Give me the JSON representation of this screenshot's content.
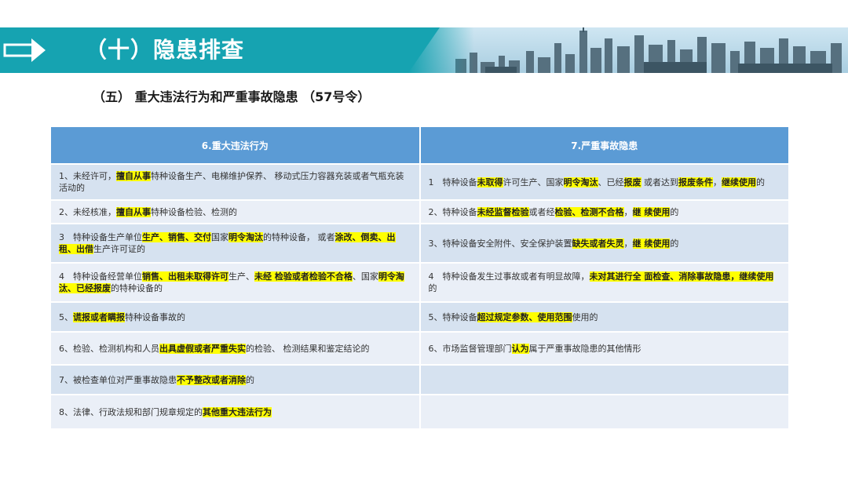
{
  "header": {
    "title": "（十）隐患排查",
    "colors": {
      "band": "#16a3b1",
      "table_header": "#5b9bd5",
      "highlight": "#ffff00"
    }
  },
  "subtitle": "（五） 重大违法行为和严重事故隐患 （57号令）",
  "table": {
    "columns": [
      "6.重大违法行为",
      "7.严重事故隐患"
    ],
    "rows": [
      [
        [
          {
            "t": "1、未经许可，"
          },
          {
            "t": "擅自从事",
            "h": true
          },
          {
            "t": "特种设备生产、电梯维护保养、 移动式压力容器充装或者气瓶充装活动的"
          }
        ],
        [
          {
            "t": "1　特种设备"
          },
          {
            "t": "未取得",
            "h": true
          },
          {
            "t": "许可生产、国家"
          },
          {
            "t": "明令淘汰",
            "h": true
          },
          {
            "t": "、已经"
          },
          {
            "t": "报废",
            "h": true
          },
          {
            "t": " 或者达到"
          },
          {
            "t": "报废条件",
            "h": true
          },
          {
            "t": "，"
          },
          {
            "t": "继续使用",
            "h": true
          },
          {
            "t": "的"
          }
        ]
      ],
      [
        [
          {
            "t": "2、未经核准，"
          },
          {
            "t": "擅自从事",
            "h": true
          },
          {
            "t": "特种设备检验、检测的"
          }
        ],
        [
          {
            "t": "2、特种设备"
          },
          {
            "t": "未经监督检验",
            "h": true
          },
          {
            "t": "或者经"
          },
          {
            "t": "检验、检测不合格",
            "h": true
          },
          {
            "t": "，"
          },
          {
            "t": "继 续使用",
            "h": true
          },
          {
            "t": "的"
          }
        ]
      ],
      [
        [
          {
            "t": "3　特种设备生产单位"
          },
          {
            "t": "生产、销售、交付",
            "h": true
          },
          {
            "t": "国家"
          },
          {
            "t": "明令淘汰",
            "h": true
          },
          {
            "t": "的特种设备， 或者"
          },
          {
            "t": "涂改、倒卖、出租、出借",
            "h": true
          },
          {
            "t": "生产许可证的"
          }
        ],
        [
          {
            "t": "3、特种设备安全附件、安全保护装置"
          },
          {
            "t": "缺失或者失灵",
            "h": true
          },
          {
            "t": "，"
          },
          {
            "t": "继 续使用",
            "h": true
          },
          {
            "t": "的"
          }
        ]
      ],
      [
        [
          {
            "t": "4　特种设备经营单位"
          },
          {
            "t": "销售、出租未取得许可",
            "h": true
          },
          {
            "t": "生产、"
          },
          {
            "t": "未经 检验或者检验不合格",
            "h": true
          },
          {
            "t": "、国家"
          },
          {
            "t": "明令淘汰、已经报废",
            "h": true
          },
          {
            "t": "的特种设备的"
          }
        ],
        [
          {
            "t": "4　特种设备发生过事故或者有明显故障，"
          },
          {
            "t": "未对其进行全 面检查、消除事故隐患，继续使用",
            "h": true
          },
          {
            "t": "的"
          }
        ]
      ],
      [
        [
          {
            "t": "5、"
          },
          {
            "t": "谎报或者瞒报",
            "h": true
          },
          {
            "t": "特种设备事故的"
          }
        ],
        [
          {
            "t": "5、特种设备"
          },
          {
            "t": "超过规定参数、使用范围",
            "h": true
          },
          {
            "t": "使用的"
          }
        ]
      ],
      [
        [
          {
            "t": "6、检验、检测机构和人员"
          },
          {
            "t": "出具虚假或者严重失实",
            "h": true
          },
          {
            "t": "的检验、 检测结果和鉴定结论的"
          }
        ],
        [
          {
            "t": "6、市场监督管理部门"
          },
          {
            "t": "认为",
            "h": true
          },
          {
            "t": "属于严重事故隐患的其他情形"
          }
        ]
      ],
      [
        [
          {
            "t": "7、被检查单位对严重事故隐患"
          },
          {
            "t": "不予整改或者消除",
            "h": true
          },
          {
            "t": "的"
          }
        ],
        []
      ],
      [
        [
          {
            "t": "8、法律、行政法规和部门规章规定的"
          },
          {
            "t": "其他重大违法行为",
            "h": true
          }
        ],
        []
      ]
    ]
  }
}
